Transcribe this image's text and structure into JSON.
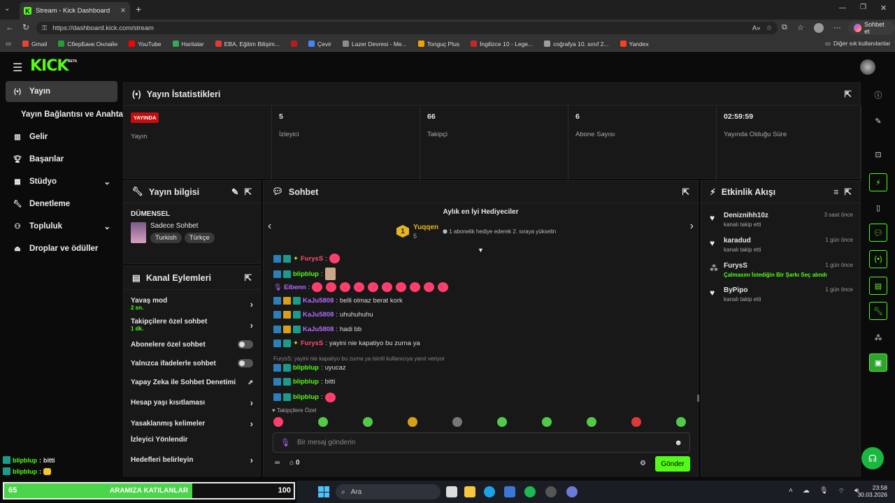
{
  "browser": {
    "tab_title": "Stream - Kick Dashboard",
    "url": "https://dashboard.kick.com/stream",
    "chat_button": "Sohbet et",
    "other_bookmarks": "Diğer sık kullanılanlar",
    "bookmarks": [
      {
        "label": "Gmail",
        "color": "#ea4335"
      },
      {
        "label": "СберБанк Онлайн",
        "color": "#21a038"
      },
      {
        "label": "YouTube",
        "color": "#ff0000"
      },
      {
        "label": "Haritalar",
        "color": "#34a853"
      },
      {
        "label": "EBA, Eğitim Bilişim...",
        "color": "#e53935"
      },
      {
        "label": "",
        "color": "#b71c1c"
      },
      {
        "label": "Çevir",
        "color": "#4285f4"
      },
      {
        "label": "Lazer Devresi - Me...",
        "color": "#8d8d8d"
      },
      {
        "label": "Tonguç Plus",
        "color": "#f4a100"
      },
      {
        "label": "İngilizce 10 - Lege...",
        "color": "#c62828"
      },
      {
        "label": "coğrafya 10. sınıf 2...",
        "color": "#9e9e9e"
      },
      {
        "label": "Yandex",
        "color": "#fc3f1d"
      }
    ]
  },
  "brand": {
    "logo": "KICK",
    "beta": "BETA",
    "accent": "#53fc18"
  },
  "sidebar": {
    "items": [
      {
        "label": "Yayın",
        "icon": "broadcast-icon"
      },
      {
        "label": "Yayın Bağlantısı ve Anahtarı",
        "icon": ""
      },
      {
        "label": "Gelir",
        "icon": "chart-icon"
      },
      {
        "label": "Başarılar",
        "icon": "trophy-icon"
      },
      {
        "label": "Stüdyo",
        "icon": "studio-icon"
      },
      {
        "label": "Denetleme",
        "icon": "wrench-icon"
      },
      {
        "label": "Topluluk",
        "icon": "community-icon"
      },
      {
        "label": "Droplar ve ödüller",
        "icon": "gift-icon"
      }
    ]
  },
  "stats": {
    "title": "Yayın İstatistikleri",
    "live_badge": "YAYINDA",
    "items": [
      {
        "value": "",
        "label": "Yayın"
      },
      {
        "value": "5",
        "label": "İzleyici"
      },
      {
        "value": "66",
        "label": "Takipçi"
      },
      {
        "value": "6",
        "label": "Abone Sayısı"
      },
      {
        "value": "02:59:59",
        "label": "Yayında Olduğu Süre"
      }
    ]
  },
  "stream_info": {
    "title": "Yayın bilgisi",
    "stream_title": "DÜMENSEL",
    "category": "Sadece Sohbet",
    "tags": [
      "Turkish",
      "Türkçe"
    ]
  },
  "channel_actions": {
    "title": "Kanal Eylemleri",
    "items": [
      {
        "label": "Yavaş mod",
        "sub": "2 sn.",
        "control": "chevron"
      },
      {
        "label": "Takipçilere özel sohbet",
        "sub": "1 dk.",
        "control": "chevron"
      },
      {
        "label": "Abonelere özel sohbet",
        "sub": "",
        "control": "toggle"
      },
      {
        "label": "Yalnızca ifadelerle sohbet",
        "sub": "",
        "control": "toggle"
      },
      {
        "label": "Yapay Zeka ile Sohbet Denetimi",
        "sub": "",
        "control": "external"
      },
      {
        "label": "Hesap yaşı kısıtlaması",
        "sub": "",
        "control": "chevron"
      },
      {
        "label": "Yasaklanmış kelimeler",
        "sub": "",
        "control": "chevron"
      },
      {
        "label": "İzleyici Yönlendir",
        "sub": "",
        "control": ""
      },
      {
        "label": "Hedefleri belirleyin",
        "sub": "",
        "control": "chevron"
      }
    ]
  },
  "chat": {
    "title": "Sohbet",
    "gifters_title": "Aylık en İyi Hediyeciler",
    "top_gifter": {
      "rank": "1",
      "name": "Yuqqen",
      "count": "5",
      "note": "1 abonelik hediye ederek 2. sıraya yükselin"
    },
    "messages": [
      {
        "user": "FurysS",
        "color": "#ff4d6d",
        "text": "",
        "emote": true
      },
      {
        "user": "blipblup",
        "color": "#53fc18",
        "text": "",
        "emote": true
      },
      {
        "user": "Eibenn",
        "color": "#b36bff",
        "text": "",
        "emote_row": 10
      },
      {
        "user": "KaJu5808",
        "color": "#b36bff",
        "text": "belli olmaz berat kork"
      },
      {
        "user": "KaJu5808",
        "color": "#b36bff",
        "text": "uhuhuhuhu"
      },
      {
        "user": "KaJu5808",
        "color": "#b36bff",
        "text": "hadi bb"
      },
      {
        "user": "FurysS",
        "color": "#ff4d6d",
        "text": "yayini nie kapatiyo bu zurna ya"
      },
      {
        "user": "blipblup",
        "color": "#53fc18",
        "text": "uyucaz",
        "reply": "FurysS: yayini nie kapatiyo bu zurna ya isimli kullanıcıya yanıt veriyor"
      },
      {
        "user": "blipblup",
        "color": "#53fc18",
        "text": "bitti"
      },
      {
        "user": "blipblup",
        "color": "#53fc18",
        "text": "",
        "emote": true
      }
    ],
    "followers_only": "Takipçilere Özel",
    "input_placeholder": "Bir mesaj gönderin",
    "points": "0",
    "send_label": "Gönder"
  },
  "activity": {
    "title": "Etkinlik Akışı",
    "items": [
      {
        "name": "Deniznihh10z",
        "desc": "kanalı takip etti",
        "time": "3 saat önce",
        "icon": "heart-icon"
      },
      {
        "name": "karadud",
        "desc": "kanalı takip etti",
        "time": "1 gün önce",
        "icon": "heart-icon"
      },
      {
        "name": "FurysS",
        "desc": "Çalmasını İstediğin Bir Şarkı Seç alındı",
        "time": "1 gün önce",
        "icon": "points-icon"
      },
      {
        "name": "ByPipo",
        "desc": "kanalı takip etti",
        "time": "1 gün önce",
        "icon": "heart-icon"
      }
    ]
  },
  "overlay": {
    "chat_lines": [
      {
        "user": "blipblup",
        "text": "bitti"
      },
      {
        "user": "blipblup",
        "text": ""
      }
    ],
    "bar_left": "65",
    "bar_title": "ARAMIZA KATILANLAR",
    "bar_right": "100",
    "bar_progress": 0.65
  },
  "taskbar": {
    "search": "Ara",
    "time": "23:58",
    "date": "30.03.2026"
  }
}
